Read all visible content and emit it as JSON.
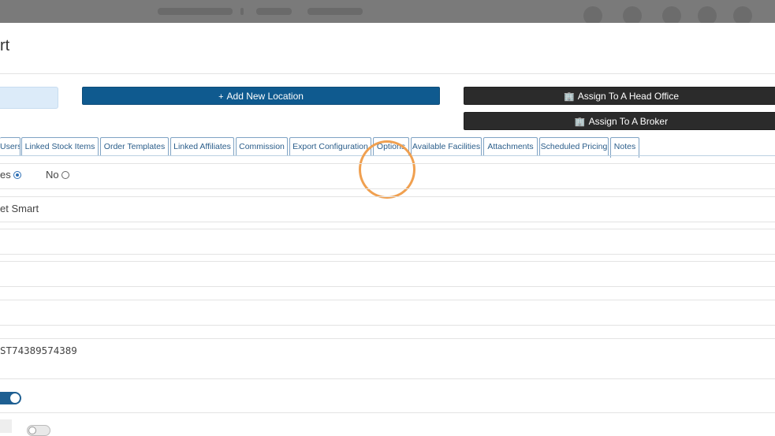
{
  "page": {
    "title": "rt"
  },
  "actions": {
    "add_location": {
      "icon": "plus-icon",
      "glyph": "+",
      "label": "Add New Location"
    },
    "assign_head_office": {
      "icon": "building-icon",
      "glyph": "🏢",
      "label": "Assign To A Head Office"
    },
    "assign_broker": {
      "icon": "building-icon",
      "glyph": "🏢",
      "label": "Assign To A Broker"
    }
  },
  "tabs": [
    {
      "key": "users",
      "label": "Users"
    },
    {
      "key": "linked-stock-items",
      "label": "Linked Stock Items"
    },
    {
      "key": "order-templates",
      "label": "Order Templates"
    },
    {
      "key": "linked-affiliates",
      "label": "Linked Affiliates"
    },
    {
      "key": "commission",
      "label": "Commission"
    },
    {
      "key": "export-configuration",
      "label": "Export Configuration"
    },
    {
      "key": "options",
      "label": "Options"
    },
    {
      "key": "available-facilities",
      "label": "Available Facilities"
    },
    {
      "key": "attachments",
      "label": "Attachments"
    },
    {
      "key": "scheduled-pricing",
      "label": "Scheduled Pricing"
    },
    {
      "key": "notes",
      "label": "Notes"
    }
  ],
  "form": {
    "yes_label": "es",
    "no_label": "No",
    "yes_checked": true,
    "name_value": "et Smart",
    "code_value": "ST74389574389",
    "toggle_1_on": true,
    "toggle_2_on": false
  },
  "colors": {
    "primary": "#0f5a8f",
    "dark_button": "#2b2b2b",
    "tab_text": "#2a5d8a",
    "highlight": "#f0a050"
  }
}
